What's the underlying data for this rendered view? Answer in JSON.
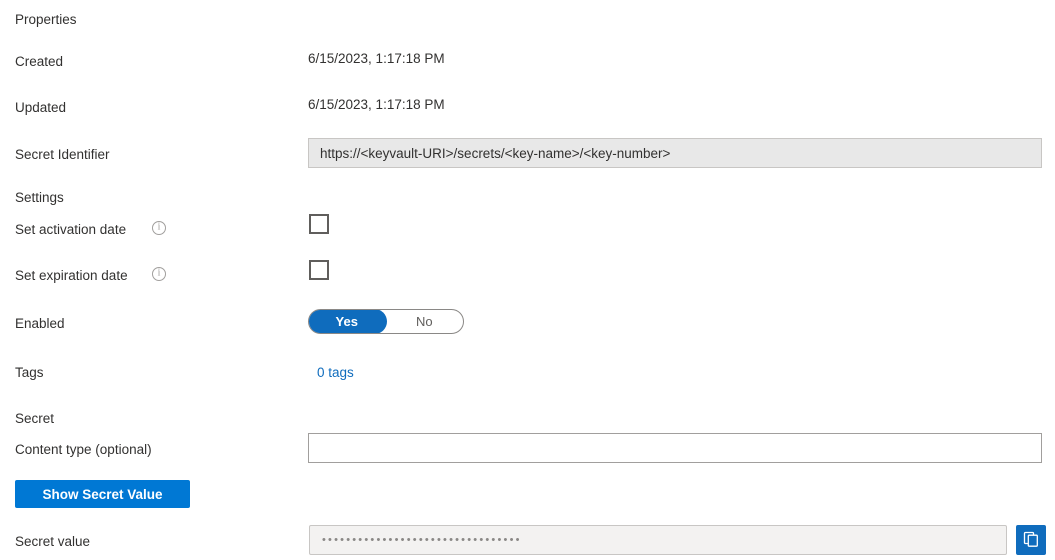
{
  "sections": {
    "properties_title": "Properties",
    "settings_title": "Settings",
    "secret_title": "Secret"
  },
  "properties": {
    "created_label": "Created",
    "created_value": "6/15/2023, 1:17:18 PM",
    "updated_label": "Updated",
    "updated_value": "6/15/2023, 1:17:18 PM",
    "secret_identifier_label": "Secret Identifier",
    "secret_identifier_value": "https://<keyvault-URI>/secrets/<key-name>/<key-number>"
  },
  "settings": {
    "activation_label": "Set activation date",
    "activation_checked": false,
    "expiration_label": "Set expiration date",
    "expiration_checked": false,
    "enabled_label": "Enabled",
    "enabled_yes": "Yes",
    "enabled_no": "No",
    "enabled_selected": "Yes",
    "tags_label": "Tags",
    "tags_link": "0 tags"
  },
  "secret": {
    "content_type_label": "Content type (optional)",
    "content_type_value": "",
    "content_type_placeholder": "",
    "show_secret_button": "Show Secret Value",
    "secret_value_label": "Secret value",
    "secret_value_masked": "•••••••••••••••••••••••••••••••••",
    "copy_icon": "copy-icon"
  },
  "colors": {
    "accent": "#0078d4",
    "link": "#0f6cbd",
    "text": "#323130",
    "readonly_bg": "#e8e8e8",
    "masked_bg": "#f3f2f1"
  }
}
